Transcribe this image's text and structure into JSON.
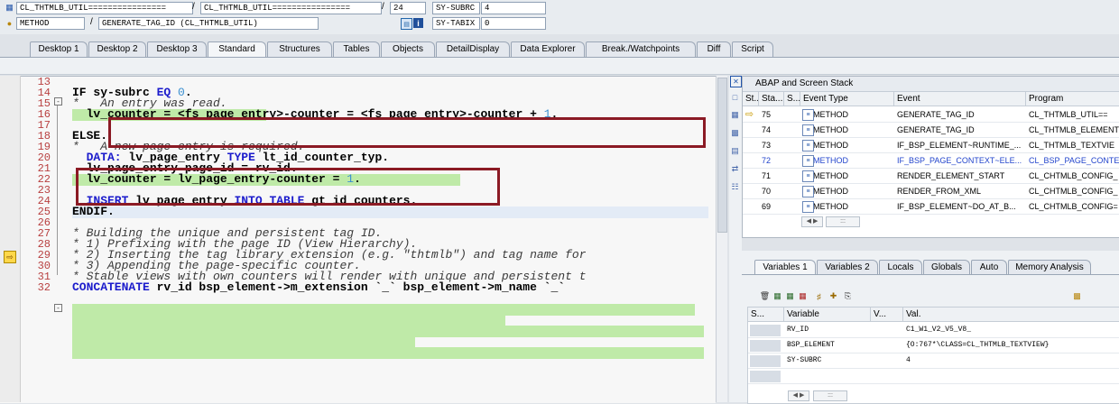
{
  "header": {
    "row1": {
      "field1": "CL_THTMLB_UTIL================",
      "sep1": "/",
      "field2": "CL_THTMLB_UTIL================",
      "sep2": "/",
      "line_no": "24",
      "sysvar1_name": "SY-SUBRC",
      "sysvar1_value": "4"
    },
    "row2": {
      "type": "METHOD",
      "sep1": "/",
      "method": "GENERATE_TAG_ID (CL_THTMLB_UTIL)",
      "sysvar2_name": "SY-TABIX",
      "sysvar2_value": "0"
    }
  },
  "tabs": [
    "Desktop 1",
    "Desktop 2",
    "Desktop 3",
    "Standard",
    "Structures",
    "Tables",
    "Objects",
    "DetailDisplay",
    "Data Explorer",
    "Break./Watchpoints",
    "Diff",
    "Script"
  ],
  "active_tab": "Standard",
  "code": {
    "line_numbers": [
      "13",
      "14",
      "15",
      "16",
      "17",
      "18",
      "19",
      "20",
      "21",
      "22",
      "23",
      "24",
      "25",
      "26",
      "27",
      "28",
      "29",
      "30",
      "31",
      "32"
    ],
    "lines": [
      {
        "parts": [
          {
            "t": "",
            "c": ""
          }
        ]
      },
      {
        "parts": [
          {
            "t": "IF ",
            "c": "bold"
          },
          {
            "t": "sy-subrc ",
            "c": "bold"
          },
          {
            "t": "EQ ",
            "c": "kw"
          },
          {
            "t": "0",
            "c": "num"
          },
          {
            "t": ".",
            "c": "bold"
          }
        ]
      },
      {
        "parts": [
          {
            "t": "*   An entry was read.",
            "c": "cm"
          }
        ]
      },
      {
        "parts": [
          {
            "t": "  lv_counter = <fs_page_entry>-counter = <fs_page_entry>-counter + ",
            "c": "bold"
          },
          {
            "t": "1",
            "c": "num"
          },
          {
            "t": ".",
            "c": "bold"
          }
        ]
      },
      {
        "parts": [
          {
            "t": "",
            "c": ""
          }
        ]
      },
      {
        "parts": [
          {
            "t": "ELSE.",
            "c": "bold"
          }
        ]
      },
      {
        "parts": [
          {
            "t": "*   A new page entry is required.",
            "c": "cm"
          }
        ]
      },
      {
        "parts": [
          {
            "t": "  DATA: ",
            "c": "kw"
          },
          {
            "t": "lv_page_entry ",
            "c": "bold"
          },
          {
            "t": "TYPE ",
            "c": "kw"
          },
          {
            "t": "lt_id_counter_typ.",
            "c": "bold"
          }
        ]
      },
      {
        "parts": [
          {
            "t": "  lv_page_entry-page_id = rv_id.",
            "c": "bold"
          }
        ]
      },
      {
        "parts": [
          {
            "t": "  lv_counter = lv_page_entry-counter = ",
            "c": "bold"
          },
          {
            "t": "1",
            "c": "num"
          },
          {
            "t": ".",
            "c": "bold"
          }
        ]
      },
      {
        "parts": [
          {
            "t": "",
            "c": ""
          }
        ]
      },
      {
        "parts": [
          {
            "t": "  INSERT ",
            "c": "kw"
          },
          {
            "t": "lv_page_entry ",
            "c": "bold"
          },
          {
            "t": "INTO TABLE ",
            "c": "kw"
          },
          {
            "t": "gt_id_counters.",
            "c": "bold"
          }
        ]
      },
      {
        "parts": [
          {
            "t": "ENDIF.",
            "c": "bold"
          }
        ]
      },
      {
        "parts": [
          {
            "t": "",
            "c": ""
          }
        ]
      },
      {
        "parts": [
          {
            "t": "* Building the unique and persistent tag ID.",
            "c": "cm"
          }
        ]
      },
      {
        "parts": [
          {
            "t": "* 1) Prefixing with the page ID (View Hierarchy).",
            "c": "cm"
          }
        ]
      },
      {
        "parts": [
          {
            "t": "* 2) Inserting the tag library extension (e.g. \"thtmlb\") and tag name for",
            "c": "cm"
          }
        ]
      },
      {
        "parts": [
          {
            "t": "* 3) Appending the page-specific counter.",
            "c": "cm"
          }
        ]
      },
      {
        "parts": [
          {
            "t": "* Stable views with own counters will render with unique and persistent t",
            "c": "cm"
          }
        ]
      },
      {
        "parts": [
          {
            "t": "CONCATENATE ",
            "c": "kw"
          },
          {
            "t": "rv_id bsp_element->m_extension `_` bsp_element->m_name `_` ",
            "c": "bold"
          }
        ]
      }
    ]
  },
  "stack": {
    "title": "ABAP and Screen Stack",
    "columns": [
      "St...",
      "Sta...",
      "S...",
      "Event Type",
      "Event",
      "Program"
    ],
    "rows": [
      {
        "level": "75",
        "type": "METHOD",
        "event": "GENERATE_TAG_ID",
        "program": "CL_THTMLB_UTIL=="
      },
      {
        "level": "74",
        "type": "METHOD",
        "event": "GENERATE_TAG_ID",
        "program": "CL_THTMLB_ELEMENT"
      },
      {
        "level": "73",
        "type": "METHOD",
        "event": "IF_BSP_ELEMENT~RUNTIME_...",
        "program": "CL_THTMLB_TEXTVIE"
      },
      {
        "level": "72",
        "type": "METHOD",
        "event": "IF_BSP_PAGE_CONTEXT~ELE...",
        "program": "CL_BSP_PAGE_CONTE"
      },
      {
        "level": "71",
        "type": "METHOD",
        "event": "RENDER_ELEMENT_START",
        "program": "CL_CHTMLB_CONFIG_"
      },
      {
        "level": "70",
        "type": "METHOD",
        "event": "RENDER_FROM_XML",
        "program": "CL_CHTMLB_CONFIG_"
      },
      {
        "level": "69",
        "type": "METHOD",
        "event": "IF_BSP_ELEMENT~DO_AT_B...",
        "program": "CL_CHTMLB_CONFIG="
      }
    ]
  },
  "variables": {
    "tabs": [
      "Variables 1",
      "Variables 2",
      "Locals",
      "Globals",
      "Auto",
      "Memory Analysis"
    ],
    "columns": [
      "S...",
      "Variable",
      "V...",
      "Val."
    ],
    "rows": [
      {
        "name": "RV_ID",
        "value": "C1_W1_V2_V5_V8_"
      },
      {
        "name": "BSP_ELEMENT",
        "value": "{O:767*\\CLASS=CL_THTMLB_TEXTVIEW}"
      },
      {
        "name": "SY-SUBRC",
        "value": "4"
      },
      {
        "name": "",
        "value": ""
      }
    ]
  },
  "colors": {
    "highlight": "#bfeaa8",
    "annotation_box": "#8b1a24",
    "keyword": "#1c1ccc",
    "line_number": "#b84040"
  }
}
